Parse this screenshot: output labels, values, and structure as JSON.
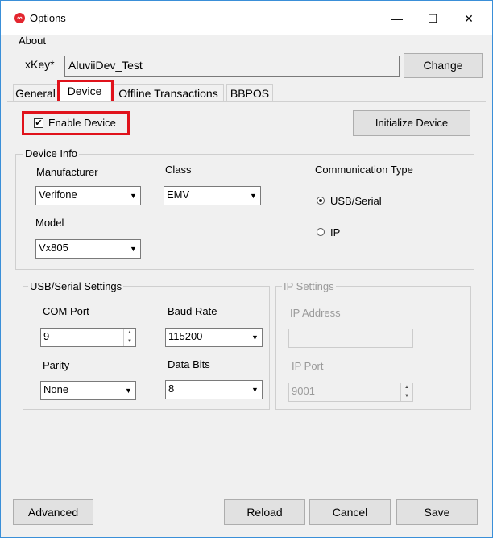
{
  "window": {
    "title": "Options",
    "app_icon": "app-logo-icon",
    "min_glyph": "—",
    "max_glyph": "☐",
    "close_glyph": "✕"
  },
  "menu": {
    "about": "About"
  },
  "xkey": {
    "label": "xKey*",
    "value": "AluviiDev_Test",
    "change_button": "Change"
  },
  "tabs": [
    {
      "label": "General"
    },
    {
      "label": "Device",
      "selected": true
    },
    {
      "label": "Offline Transactions"
    },
    {
      "label": "BBPOS"
    }
  ],
  "device": {
    "enable_label": "Enable Device",
    "enable_checked": true,
    "initialize_button": "Initialize Device"
  },
  "device_info": {
    "legend": "Device Info",
    "manufacturer_label": "Manufacturer",
    "manufacturer_value": "Verifone",
    "class_label": "Class",
    "class_value": "EMV",
    "model_label": "Model",
    "model_value": "Vx805",
    "comm_label": "Communication Type",
    "comm_options": [
      "USB/Serial",
      "IP"
    ],
    "comm_selected": "USB/Serial"
  },
  "usb_settings": {
    "legend": "USB/Serial Settings",
    "com_port_label": "COM Port",
    "com_port_value": "9",
    "baud_rate_label": "Baud Rate",
    "baud_rate_value": "115200",
    "parity_label": "Parity",
    "parity_value": "None",
    "data_bits_label": "Data Bits",
    "data_bits_value": "8"
  },
  "ip_settings": {
    "legend": "IP Settings",
    "ip_address_label": "IP Address",
    "ip_address_value": "",
    "ip_port_label": "IP Port",
    "ip_port_value": "9001"
  },
  "footer": {
    "advanced": "Advanced",
    "reload": "Reload",
    "cancel": "Cancel",
    "save": "Save"
  },
  "colors": {
    "highlight": "#e0121b",
    "accent": "#e3262f"
  }
}
